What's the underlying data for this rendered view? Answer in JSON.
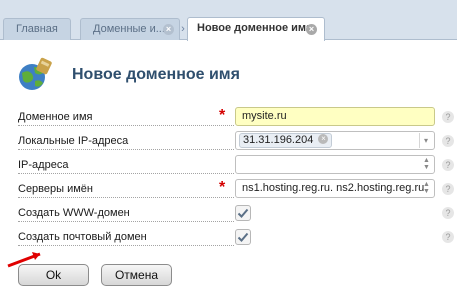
{
  "tabs": [
    {
      "label": "Главная"
    },
    {
      "label": "Доменные и..."
    },
    {
      "label": "Новое доменное имя"
    }
  ],
  "icons": {
    "page": "globe-icon",
    "close": "close-icon",
    "chevron": "chevron-right-icon",
    "help": "help-icon",
    "check": "check-icon"
  },
  "colors": {
    "accent": "#2f4f6e",
    "required": "#d40000",
    "highlight_field": "#ffffc2"
  },
  "page": {
    "title": "Новое доменное имя"
  },
  "form": {
    "domain": {
      "label": "Доменное имя",
      "value": "mysite.ru",
      "required": true
    },
    "local_ips": {
      "label": "Локальные IP-адреса",
      "selected": "31.31.196.204"
    },
    "ips": {
      "label": "IP-адреса",
      "value": ""
    },
    "nameservers": {
      "label": "Серверы имён",
      "value": "ns1.hosting.reg.ru. ns2.hosting.reg.ru.",
      "required": true
    },
    "create_www": {
      "label": "Создать WWW-домен",
      "checked": true
    },
    "create_mail": {
      "label": "Создать почтовый домен",
      "checked": true
    }
  },
  "buttons": {
    "ok": "Ok",
    "cancel": "Отмена"
  }
}
